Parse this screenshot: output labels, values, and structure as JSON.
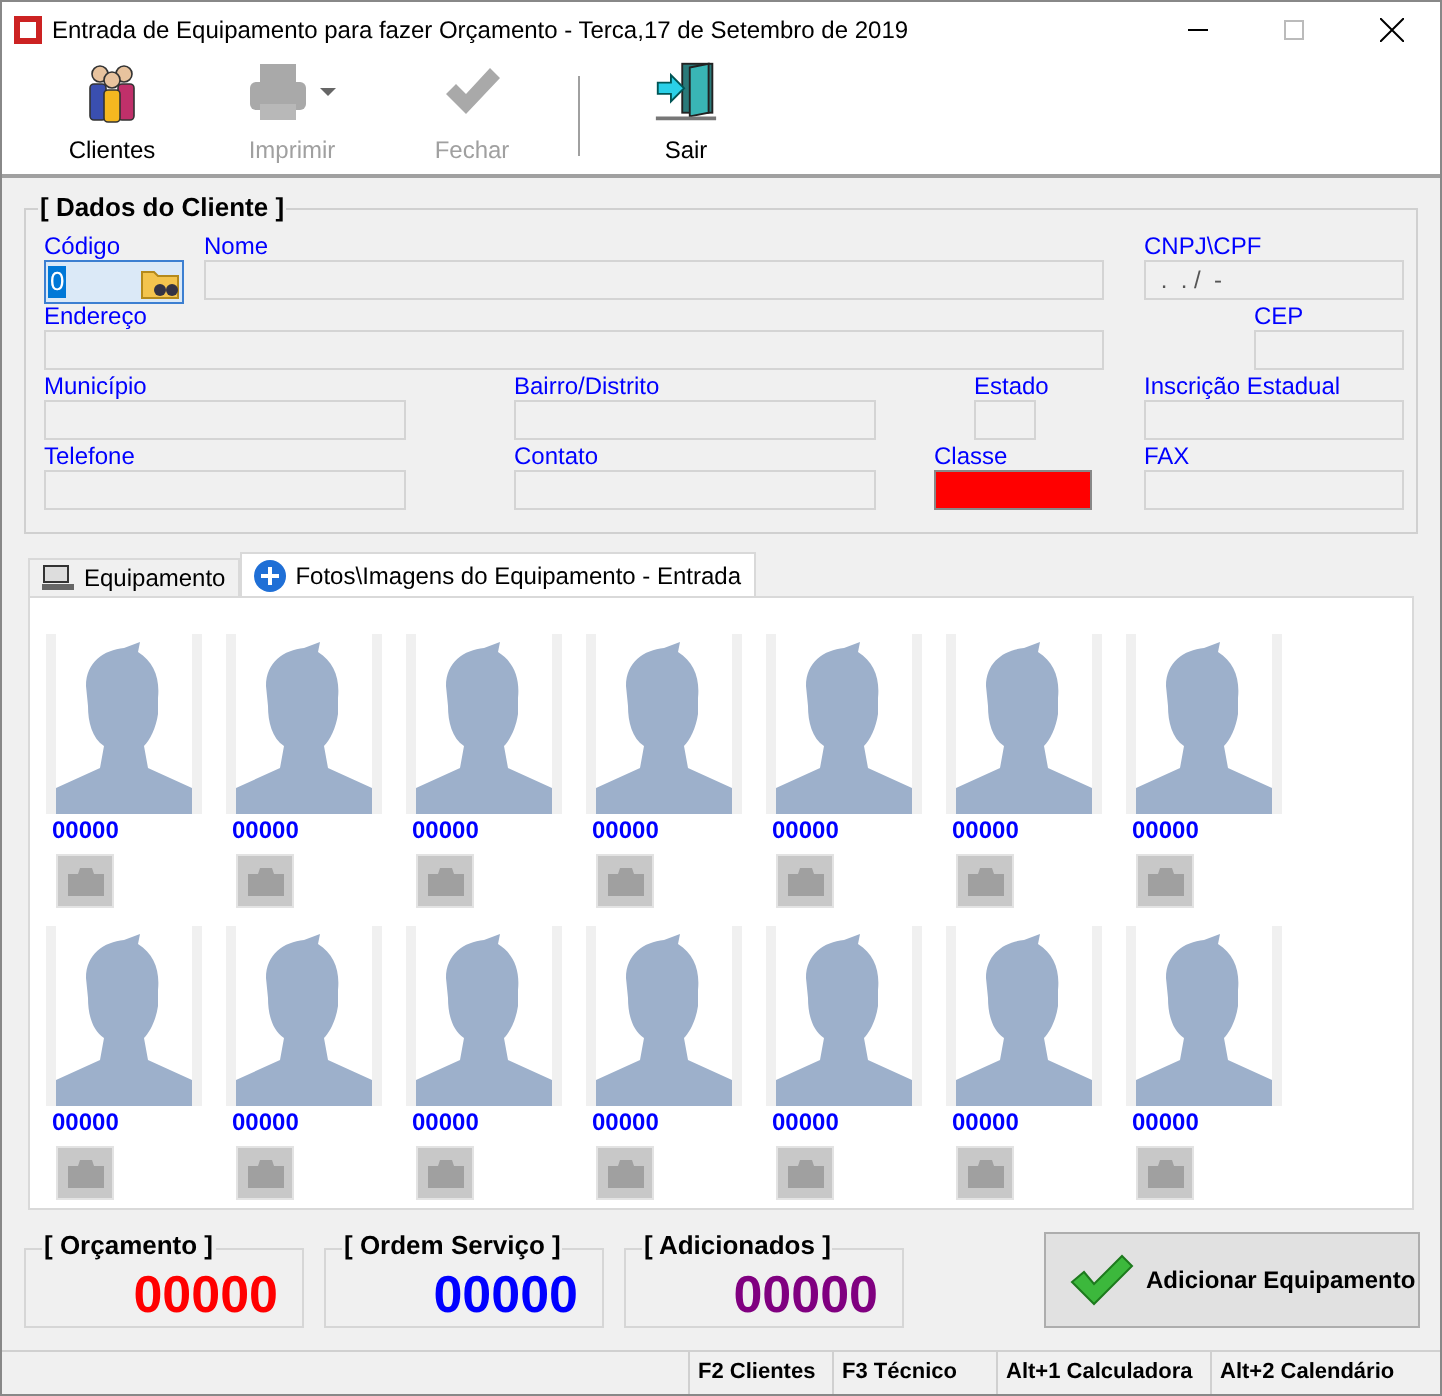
{
  "window": {
    "title": "Entrada de Equipamento para fazer Orçamento - Terca,17 de Setembro de 2019"
  },
  "toolbar": [
    {
      "label": "Clientes",
      "disabled": false,
      "kind": "clients"
    },
    {
      "label": "Imprimir",
      "disabled": true,
      "kind": "print"
    },
    {
      "label": "Fechar",
      "disabled": true,
      "kind": "check"
    },
    {
      "label": "Sair",
      "disabled": false,
      "kind": "exit"
    }
  ],
  "client_group": {
    "title": "[ Dados do Cliente ]",
    "fields": [
      {
        "label": "Código",
        "value": "0",
        "kind": "lookup"
      },
      {
        "label": "Nome",
        "kind": "text"
      },
      {
        "label": "CNPJ\\CPF",
        "value": " .  . /  -",
        "kind": "text"
      },
      {
        "label": "Endereço",
        "kind": "text"
      },
      {
        "label": "CEP",
        "kind": "text"
      },
      {
        "label": "Município",
        "kind": "text"
      },
      {
        "label": "Bairro/Distrito",
        "kind": "text"
      },
      {
        "label": "Estado",
        "kind": "text"
      },
      {
        "label": "Inscrição Estadual",
        "kind": "text"
      },
      {
        "label": "Telefone",
        "kind": "text"
      },
      {
        "label": "Contato",
        "kind": "text"
      },
      {
        "label": "Classe",
        "kind": "color",
        "color": "#ff0000"
      },
      {
        "label": "FAX",
        "kind": "text"
      }
    ]
  },
  "tabs": [
    {
      "label": "Equipamento",
      "selected": false,
      "kind": "computer"
    },
    {
      "label": "Fotos\\Imagens do Equipamento - Entrada",
      "selected": true,
      "kind": "plus"
    }
  ],
  "photos": [
    {
      "code": "00000"
    },
    {
      "code": "00000"
    },
    {
      "code": "00000"
    },
    {
      "code": "00000"
    },
    {
      "code": "00000"
    },
    {
      "code": "00000"
    },
    {
      "code": "00000"
    },
    {
      "code": "00000"
    },
    {
      "code": "00000"
    },
    {
      "code": "00000"
    },
    {
      "code": "00000"
    },
    {
      "code": "00000"
    },
    {
      "code": "00000"
    },
    {
      "code": "00000"
    }
  ],
  "counters": [
    {
      "title": "[ Orçamento ]",
      "value": "00000",
      "color": "#ff0000"
    },
    {
      "title": "[ Ordem Serviço ]",
      "value": "00000",
      "color": "#0000ff"
    },
    {
      "title": "[ Adicionados ]",
      "value": "00000",
      "color": "#800080"
    }
  ],
  "add_button": {
    "label": "Adicionar Equipamento"
  },
  "status_bar": [
    "F2 Clientes",
    "F3 Técnico",
    "Alt+1 Calculadora",
    "Alt+2 Calendário"
  ]
}
